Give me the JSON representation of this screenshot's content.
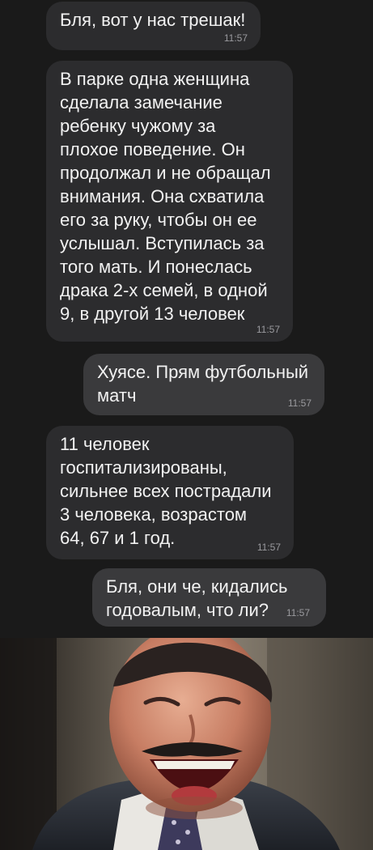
{
  "messages": [
    {
      "id": "m1",
      "direction": "incoming",
      "text": "Бля, вот у нас трешак!",
      "time": "11:57"
    },
    {
      "id": "m2",
      "direction": "incoming",
      "text": "В парке одна женщина\nсделала замечание\nребенку чужому за\nплохое поведение. Он\nпродолжал и не обращал\nвнимания. Она схватила\nего за руку, чтобы он ее\nуслышал. Вступилась за\nтого мать. И понеслась\nдрака 2-х семей, в одной\n9, в другой 13 человек",
      "time": "11:57"
    },
    {
      "id": "m3",
      "direction": "outgoing",
      "text": "Хуясе. Прям футбольный\nматч",
      "time": "11:57"
    },
    {
      "id": "m4",
      "direction": "incoming",
      "text": "11 человек\nгоспитализированы,\nсильнее всех пострадали\n3 человека, возрастом\n64, 67 и 1 год.",
      "time": "11:57"
    },
    {
      "id": "m5",
      "direction": "outgoing",
      "text": "Бля, они че, кидались\nгодовалым, что ли?",
      "time": "11:57"
    }
  ],
  "colors": {
    "background": "#1a1a1a",
    "incoming_bubble": "#2c2c2e",
    "outgoing_bubble": "#3a3a3c",
    "text": "#f2f2f2",
    "timestamp": "#9a9a9e"
  },
  "image": {
    "subject": "laughing-man-meme"
  }
}
